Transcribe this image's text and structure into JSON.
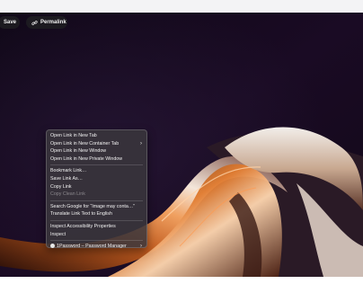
{
  "toolbar": {
    "save_label": "Save",
    "permalink_label": "Permalink",
    "link_icon": "link-icon"
  },
  "context_menu": {
    "group1": [
      {
        "label": "Open Link in New Tab"
      },
      {
        "label": "Open Link in New Container Tab",
        "submenu": "›"
      },
      {
        "label": "Open Link in New Window"
      },
      {
        "label": "Open Link in New Private Window"
      }
    ],
    "group2": [
      {
        "label": "Bookmark Link…"
      },
      {
        "label": "Save Link As…"
      },
      {
        "label": "Copy Link"
      },
      {
        "label": "Copy Clean Link",
        "disabled": true
      }
    ],
    "group3": [
      {
        "label": "Search Google for “Image may conta…”"
      },
      {
        "label": "Translate Link Text to English"
      }
    ],
    "group4": [
      {
        "label": "Inspect Accessibility Properties"
      },
      {
        "label": "Inspect"
      }
    ],
    "group5": [
      {
        "label": "1Password – Password Manager",
        "submenu": "›",
        "icon": "1password-icon"
      }
    ]
  },
  "colors": {
    "background_dark": "#15091d",
    "ribbon_orange": "#e0782c",
    "ribbon_highlight": "#f2e2d4",
    "menu_bg": "#3a373c"
  }
}
